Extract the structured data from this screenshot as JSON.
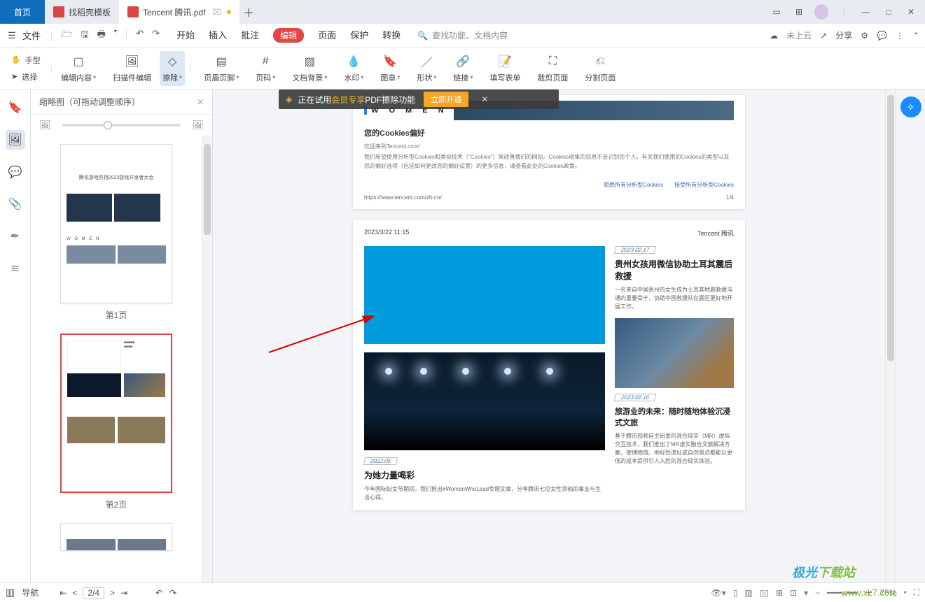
{
  "titlebar": {
    "home": "首页",
    "tab_template": "找稻壳模板",
    "tab_active": "Tencent 腾讯.pdf"
  },
  "menubar": {
    "file": "文件",
    "tabs": [
      "开始",
      "插入",
      "批注",
      "编辑",
      "页面",
      "保护",
      "转换"
    ],
    "search_placeholder": "查找功能、文档内容",
    "cloud": "未上云",
    "share": "分享"
  },
  "lefttools": {
    "hand": "手型",
    "select": "选择"
  },
  "toolbar": {
    "edit_content": "编辑内容",
    "scan_edit": "扫描件编辑",
    "erase": "擦除",
    "header_footer": "页眉页脚",
    "page_num": "页码",
    "bg": "文档背景",
    "watermark": "水印",
    "stamp": "图章",
    "shape": "形状",
    "link": "链接",
    "fill_form": "填写表单",
    "crop": "裁剪页面",
    "split": "分割页面"
  },
  "sidebar_head": "缩略图（可拖动调整顺序）",
  "thumbs": {
    "p1": "第1页",
    "p2": "第2页"
  },
  "thumb1_line1": "腾讯游戏亮相2023游戏开发者大会",
  "banner": {
    "prefix": "正在试用",
    "gold": "会员专享",
    "suffix": "PDF擦除功能",
    "open": "立即开通"
  },
  "page1": {
    "women": "W  O  M  E  N",
    "ck_title": "您的Cookies偏好",
    "ck_hi": "欢迎来到Tencent.com!",
    "ck_body": "我们希望使用分析型Cookies和类似技术（\"Cookies\"）来改善我们的网站。Cookies收集的信息不会识别您个人。有关我们使用的Cookies的类型以及您的偏好选项（包括如何更改您的偏好设置）的更多信息，请查看此处的Cookies政策。",
    "reject": "拒绝所有分析型Cookies",
    "accept": "接受所有分析型Cookies",
    "url": "https://www.tencent.com/zh-cn/",
    "pg": "1/4"
  },
  "page2": {
    "ts": "2023/3/22 11:15",
    "brand": "Tencent 腾讯",
    "d1": "2023.02.17",
    "t1": "贵州女孩用微信协助土耳其震后救援",
    "b1": "一名来自中国贵州的女生成为土耳其地震救援沟通的重要骨干，协助中国救援队在震区更好地开展工作。",
    "d2": "2022.05",
    "t2": "为她力量喝彩",
    "b2": "今年国际妇女节期间，我们推出#WomenWhoLead专题文章，分享腾讯七位女性领袖的事业与生活心得。",
    "d3": "2023.02.16",
    "t3": "旅游业的未来：随时随地体验沉浸式文旅",
    "b3": "基于腾讯视频自主研发的混合现实（MR）虚拟交互技术，我们推出了MR虚实融合文旅解决方案，使博物馆、地标性遗址或自然景点都能以更低的成本提供引人入胜的混合现实体验。"
  },
  "status": {
    "nav": "导航",
    "page": "2/4",
    "zoom": "75%"
  },
  "wm1a": "极光",
  "wm1b": "下载站",
  "wm2": "www.xz7.com"
}
